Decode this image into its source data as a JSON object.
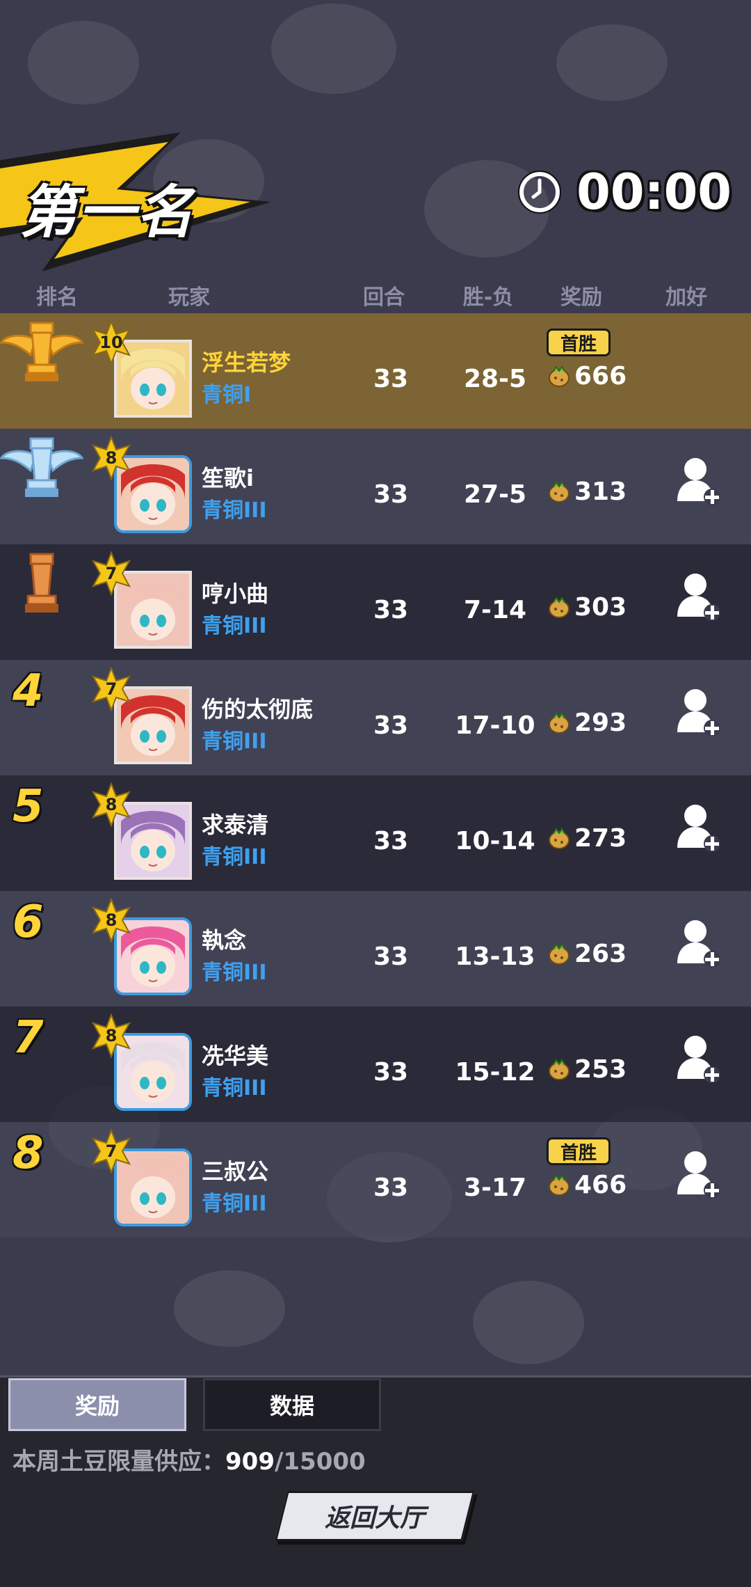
{
  "header": {
    "title": "第一名",
    "timer": "00:00"
  },
  "columns": [
    "排名",
    "玩家",
    "回合",
    "胜-负",
    "奖励",
    "加好友"
  ],
  "rows": [
    {
      "rank": "1",
      "trophy": "gold",
      "level": "10",
      "name": "浮生若梦",
      "tier": "青铜I",
      "rounds": "33",
      "winloss": "28-5",
      "reward": "666",
      "first_win": "首胜",
      "add_friend": false,
      "frame": "plain",
      "avatar_color": "#f3d28a",
      "hair": "#f6e39a"
    },
    {
      "rank": "2",
      "trophy": "silver",
      "level": "8",
      "name": "笙歌i",
      "tier": "青铜III",
      "rounds": "33",
      "winloss": "27-5",
      "reward": "313",
      "add_friend": true,
      "frame": "blue",
      "avatar_color": "#f1c9b5",
      "hair": "#d2322e"
    },
    {
      "rank": "3",
      "trophy": "bronze",
      "level": "7",
      "name": "哼小曲",
      "tier": "青铜III",
      "rounds": "33",
      "winloss": "7-14",
      "reward": "303",
      "add_friend": true,
      "frame": "plain",
      "avatar_color": "#f0c5b8",
      "hair": "#f1c2b5"
    },
    {
      "rank": "4",
      "level": "7",
      "name": "伤的太彻底",
      "tier": "青铜III",
      "rounds": "33",
      "winloss": "17-10",
      "reward": "293",
      "add_friend": true,
      "frame": "plain",
      "avatar_color": "#f1c9b5",
      "hair": "#d2322e"
    },
    {
      "rank": "5",
      "level": "8",
      "name": "求泰清",
      "tier": "青铜III",
      "rounds": "33",
      "winloss": "10-14",
      "reward": "273",
      "add_friend": true,
      "frame": "plain",
      "avatar_color": "#e4d0e8",
      "hair": "#9a72b8"
    },
    {
      "rank": "6",
      "level": "8",
      "name": "執念",
      "tier": "青铜III",
      "rounds": "33",
      "winloss": "13-13",
      "reward": "263",
      "add_friend": true,
      "frame": "blue",
      "avatar_color": "#f7d2d8",
      "hair": "#ec5a9c"
    },
    {
      "rank": "7",
      "level": "8",
      "name": "冼华美",
      "tier": "青铜III",
      "rounds": "33",
      "winloss": "15-12",
      "reward": "253",
      "add_friend": true,
      "frame": "blue",
      "avatar_color": "#f1e0e8",
      "hair": "#e8dce6"
    },
    {
      "rank": "8",
      "level": "7",
      "name": "三叔公",
      "tier": "青铜III",
      "rounds": "33",
      "winloss": "3-17",
      "reward": "466",
      "first_win": "首胜",
      "add_friend": true,
      "frame": "blue",
      "avatar_color": "#f0c5b8",
      "hair": "#f1c2b5"
    }
  ],
  "tabs": {
    "active": "奖励",
    "inactive": "数据"
  },
  "supply": {
    "label": "本周土豆限量供应：",
    "current": "909",
    "max": "/15000"
  },
  "back_button": "返回大厅",
  "colors": {
    "gold_row": "#7c6434",
    "accent_yellow": "#ffd43a",
    "tier_blue": "#3ea1f0"
  }
}
